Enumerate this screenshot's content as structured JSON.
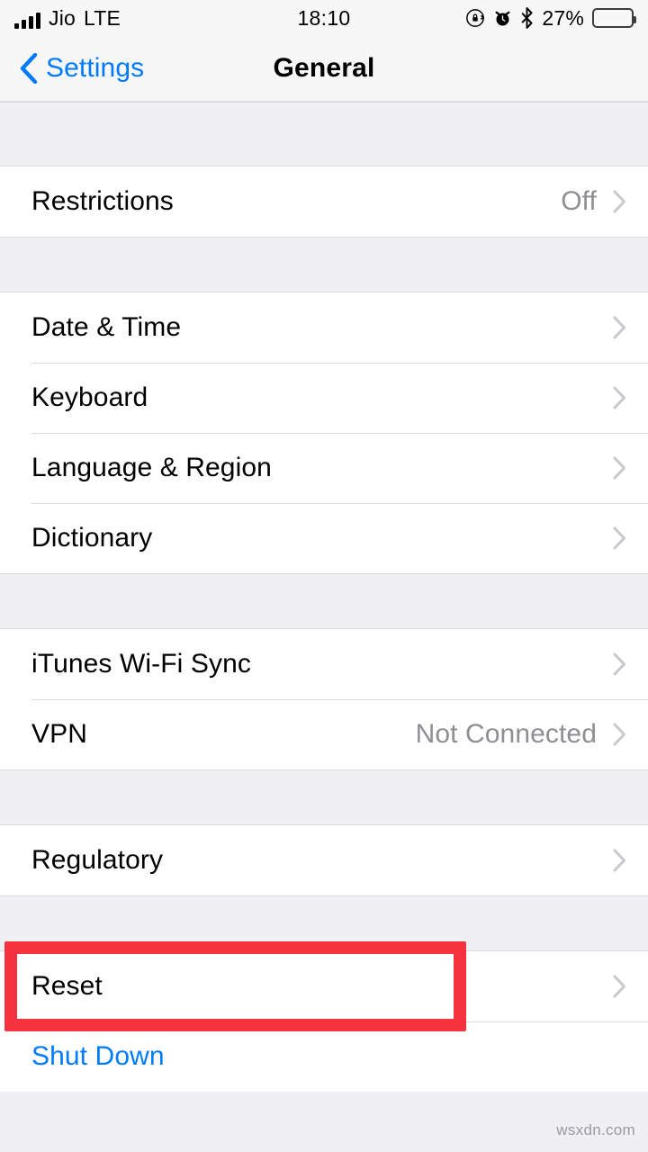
{
  "status_bar": {
    "carrier": "Jio",
    "network": "LTE",
    "time": "18:10",
    "battery_percent": "27%",
    "battery_level": 27,
    "icons": [
      "signal-bars-icon",
      "rotation-lock-icon",
      "alarm-clock-icon",
      "bluetooth-icon",
      "battery-icon"
    ]
  },
  "nav": {
    "back_label": "Settings",
    "title": "General"
  },
  "sections": [
    {
      "rows": [
        {
          "label": "Restrictions",
          "value": "Off",
          "chevron": true,
          "style": "default"
        }
      ]
    },
    {
      "rows": [
        {
          "label": "Date & Time",
          "value": "",
          "chevron": true,
          "style": "default"
        },
        {
          "label": "Keyboard",
          "value": "",
          "chevron": true,
          "style": "default"
        },
        {
          "label": "Language & Region",
          "value": "",
          "chevron": true,
          "style": "default"
        },
        {
          "label": "Dictionary",
          "value": "",
          "chevron": true,
          "style": "default"
        }
      ]
    },
    {
      "rows": [
        {
          "label": "iTunes Wi-Fi Sync",
          "value": "",
          "chevron": true,
          "style": "default"
        },
        {
          "label": "VPN",
          "value": "Not Connected",
          "chevron": true,
          "style": "default"
        }
      ]
    },
    {
      "rows": [
        {
          "label": "Regulatory",
          "value": "",
          "chevron": true,
          "style": "default"
        }
      ]
    },
    {
      "rows": [
        {
          "label": "Reset",
          "value": "",
          "chevron": true,
          "style": "default"
        },
        {
          "label": "Shut Down",
          "value": "",
          "chevron": false,
          "style": "link"
        }
      ]
    }
  ],
  "annotation": {
    "target": "Reset",
    "color": "#f5333f"
  },
  "watermark": "wsxdn.com",
  "colors": {
    "accent": "#007aff",
    "value_text": "#8e8e93",
    "chevron": "#c7c7cc",
    "group_bg": "#ffffff",
    "page_bg": "#efeff4",
    "annotation": "#f5333f"
  }
}
